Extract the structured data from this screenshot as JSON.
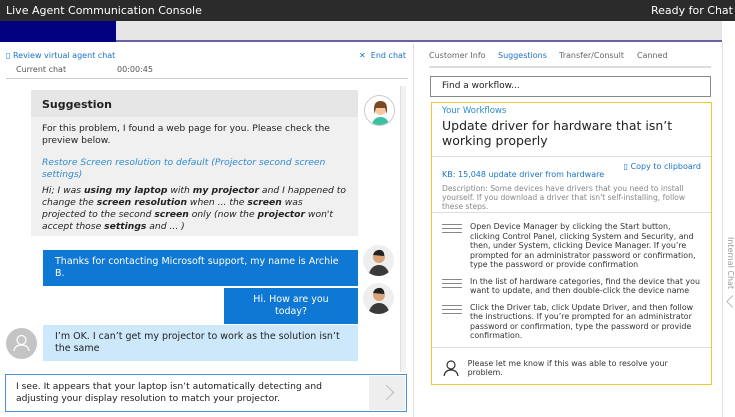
{
  "window": {
    "title": "Live Agent Communication Console",
    "status": "Ready for Chat"
  },
  "chat": {
    "review_link": "Review virtual agent chat",
    "end_chat": "End chat",
    "current_chat_label": "Current chat",
    "timer": "00:00:45",
    "suggestion": {
      "title": "Suggestion",
      "text": "For this problem, I found a web page for you. Please check the preview below.",
      "link": "Restore Screen resolution to default (Projector second screen settings)",
      "preview_parts": [
        {
          "t": "Hi; I was ",
          "b": false
        },
        {
          "t": "using my laptop",
          "b": true
        },
        {
          "t": " with ",
          "b": false
        },
        {
          "t": "my projector",
          "b": true
        },
        {
          "t": " and I happened to change the ",
          "b": false
        },
        {
          "t": "screen resolution",
          "b": true
        },
        {
          "t": " when ... the ",
          "b": false
        },
        {
          "t": "screen",
          "b": true
        },
        {
          "t": " was projected to the second ",
          "b": false
        },
        {
          "t": "screen",
          "b": true
        },
        {
          "t": " only (now the ",
          "b": false
        },
        {
          "t": "projector",
          "b": true
        },
        {
          "t": " won't accept those ",
          "b": false
        },
        {
          "t": "settings",
          "b": true
        },
        {
          "t": " and ... )",
          "b": false
        }
      ]
    },
    "messages": [
      {
        "from": "agent",
        "text": "Thanks for contacting Microsoft support, my name is Archie B."
      },
      {
        "from": "agent",
        "text": "Hi. How are you today?"
      },
      {
        "from": "customer",
        "text": "I’m OK. I can’t get my projector to work as the solution isn’t the same"
      }
    ],
    "input_value": "I see. It appears that your laptop isn’t automatically detecting and adjusting your display resolution to match your projector."
  },
  "side": {
    "tabs": [
      "Customer Info",
      "Suggestions",
      "Transfer/Consult",
      "Canned"
    ],
    "active_tab": 1,
    "search_placeholder": "Find a workflow...",
    "workflows_label": "Your Workflows",
    "workflow_title": "Update driver for hardware that isn’t working properly",
    "kb_link": "KB: 15,048 update driver from hardware",
    "copy": "Copy to clipboard",
    "description": "Description: Some devices have drivers that you need to install yourself. If you download a driver that isn't self-installing, follow these steps.",
    "steps": [
      "Open Device Manager by clicking the Start button, clicking Control Panel, clicking System and Security, and then, under System, clicking Device Manager. If you’re prompted for an administrator password or confirmation, type the password or provide confirmation",
      "In the list of hardware categories, find the device that you want to update, and then double-click the device name",
      "Click the Driver tab, click Update Driver, and then follow the instructions. If you’re prompted for an administrator password or confirmation, type the password or provide confirmation."
    ],
    "closing": "Please let me know if this was able to resolve your problem.",
    "vertical_tab": "Internal Chat"
  }
}
